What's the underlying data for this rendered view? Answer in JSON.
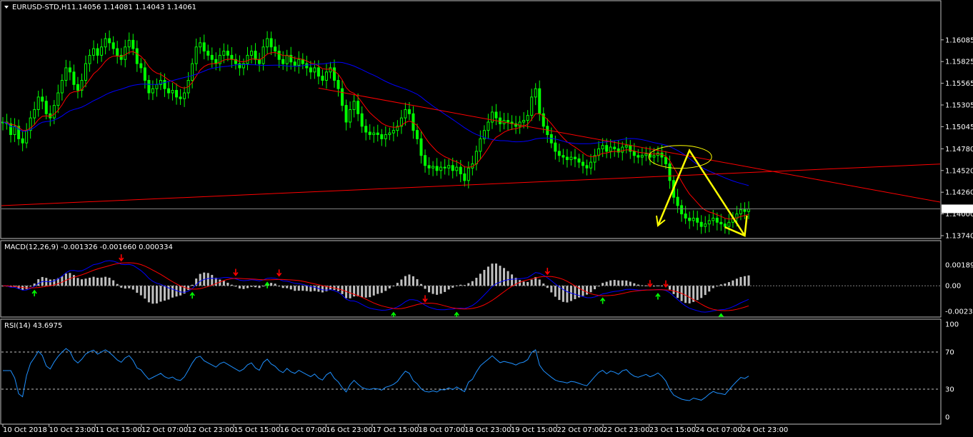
{
  "header": {
    "symbol": "EURUSD-STD,H1",
    "ohlc": "1.14056 1.14081 1.14043 1.14061",
    "macd": "MACD(12,26,9) -0.001326 -0.001660 0.000334",
    "rsi": "RSI(14) 43.6975"
  },
  "colors": {
    "background": "#000000",
    "candle": "#00ff00",
    "ma_fast": "#ff0000",
    "ma_slow": "#0000ff",
    "trendline": "#ff0000",
    "projection": "#ffff00",
    "macd_hist": "#c0c0c0",
    "rsi_line": "#1e90ff"
  },
  "chart_data": [
    {
      "type": "line",
      "panel": "price",
      "title": "EURUSD-STD,H1",
      "ylim": [
        1.1374,
        1.1628
      ],
      "y_ticks": [
        "1.16085",
        "1.15825",
        "1.15565",
        "1.15305",
        "1.15045",
        "1.14780",
        "1.14520",
        "1.14260",
        "1.14000",
        "1.13740"
      ],
      "current_price": "1.14061",
      "x_ticks": [
        "10 Oct 2018",
        "10 Oct 23:00",
        "11 Oct 15:00",
        "12 Oct 07:00",
        "12 Oct 23:00",
        "15 Oct 15:00",
        "16 Oct 07:00",
        "16 Oct 23:00",
        "17 Oct 15:00",
        "18 Oct 07:00",
        "18 Oct 23:00",
        "19 Oct 15:00",
        "22 Oct 07:00",
        "22 Oct 23:00",
        "23 Oct 15:00",
        "24 Oct 07:00",
        "24 Oct 23:00"
      ],
      "bars": 210,
      "close": [
        1.151,
        1.1508,
        1.1495,
        1.1505,
        1.149,
        1.1485,
        1.15,
        1.1515,
        1.1525,
        1.154,
        1.1535,
        1.152,
        1.1515,
        1.153,
        1.1545,
        1.156,
        1.1575,
        1.157,
        1.1555,
        1.1548,
        1.156,
        1.158,
        1.159,
        1.1598,
        1.159,
        1.16,
        1.161,
        1.1605,
        1.1598,
        1.159,
        1.1585,
        1.16,
        1.1608,
        1.1598,
        1.158,
        1.1575,
        1.156,
        1.1545,
        1.155,
        1.1555,
        1.156,
        1.155,
        1.1545,
        1.1548,
        1.154,
        1.1538,
        1.1545,
        1.156,
        1.158,
        1.16,
        1.1605,
        1.1595,
        1.159,
        1.1585,
        1.158,
        1.159,
        1.1595,
        1.159,
        1.1585,
        1.158,
        1.1575,
        1.158,
        1.159,
        1.1595,
        1.1585,
        1.158,
        1.16,
        1.161,
        1.16,
        1.1595,
        1.1585,
        1.158,
        1.159,
        1.1582,
        1.1578,
        1.1585,
        1.158,
        1.1575,
        1.157,
        1.1575,
        1.1565,
        1.156,
        1.157,
        1.1575,
        1.156,
        1.155,
        1.153,
        1.151,
        1.1525,
        1.1535,
        1.152,
        1.1505,
        1.1498,
        1.1495,
        1.1497,
        1.1495,
        1.149,
        1.1495,
        1.1497,
        1.15,
        1.1505,
        1.1515,
        1.1525,
        1.152,
        1.15,
        1.149,
        1.147,
        1.1458,
        1.1455,
        1.1457,
        1.1452,
        1.1456,
        1.1455,
        1.1458,
        1.1452,
        1.1456,
        1.1448,
        1.144,
        1.1455,
        1.146,
        1.1475,
        1.149,
        1.15,
        1.151,
        1.1522,
        1.1515,
        1.1508,
        1.1512,
        1.151,
        1.1508,
        1.1505,
        1.151,
        1.1512,
        1.1518,
        1.154,
        1.155,
        1.152,
        1.1505,
        1.1495,
        1.1485,
        1.1475,
        1.147,
        1.1468,
        1.1465,
        1.1468,
        1.1466,
        1.1462,
        1.1458,
        1.1455,
        1.1462,
        1.147,
        1.1478,
        1.1482,
        1.1475,
        1.148,
        1.1478,
        1.1474,
        1.148,
        1.1482,
        1.1475,
        1.147,
        1.1468,
        1.147,
        1.1472,
        1.1468,
        1.147,
        1.1473,
        1.1468,
        1.146,
        1.144,
        1.142,
        1.141,
        1.14,
        1.1395,
        1.1392,
        1.1395,
        1.139,
        1.1385,
        1.1388,
        1.1392,
        1.1395,
        1.139,
        1.1388,
        1.1385,
        1.139,
        1.1395,
        1.14,
        1.1405,
        1.1403,
        1.1406
      ],
      "annotations": {
        "downtrend_line": [
          [
            1.162,
            0
          ],
          [
            1.1438,
            210
          ]
        ],
        "support_line": [
          [
            1.141,
            0
          ],
          [
            1.1454,
            210
          ]
        ],
        "projection": [
          [
            1.1386,
            166
          ],
          [
            1.1476,
            174
          ],
          [
            1.1374,
            188
          ]
        ]
      }
    },
    {
      "type": "bar",
      "panel": "macd",
      "title": "MACD(12,26,9) -0.001326 -0.001660 0.000334",
      "ylim": [
        -0.00233,
        0.001899
      ],
      "y_ticks": [
        "0.001899",
        "0.00",
        "-0.00233"
      ]
    },
    {
      "type": "line",
      "panel": "rsi",
      "title": "RSI(14) 43.6975",
      "ylim": [
        0,
        100
      ],
      "y_ticks": [
        "100",
        "70",
        "30",
        "0"
      ],
      "levels": [
        70,
        30
      ]
    }
  ]
}
